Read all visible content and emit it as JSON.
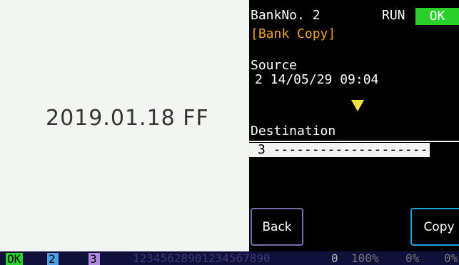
{
  "left_panel": {
    "date": "2019.01.18 FF"
  },
  "screen": {
    "bank_label": "BankNo. 2",
    "run_label": "RUN",
    "ok_label": "OK",
    "mode_label": "[Bank Copy]",
    "source_label": "Source",
    "source_value": "2 14/05/29 09:04",
    "destination_label": "Destination",
    "destination_value": "3 --------------------",
    "back_button": "Back",
    "copy_button": "Copy"
  },
  "status_bar": {
    "ok": "OK",
    "slot2": "2",
    "slot3": "3",
    "digits": "12345628901234567890",
    "zero": "0",
    "pct1": "100%",
    "pct2": "0%",
    "pct3": "0%"
  },
  "colors": {
    "ok_green": "#2ad02a",
    "mode_orange": "#f0a520",
    "arrow_yellow": "#f0e040",
    "copy_border": "#1aa0e0",
    "back_border": "#7a6aa8",
    "status_bg": "#10103a"
  }
}
